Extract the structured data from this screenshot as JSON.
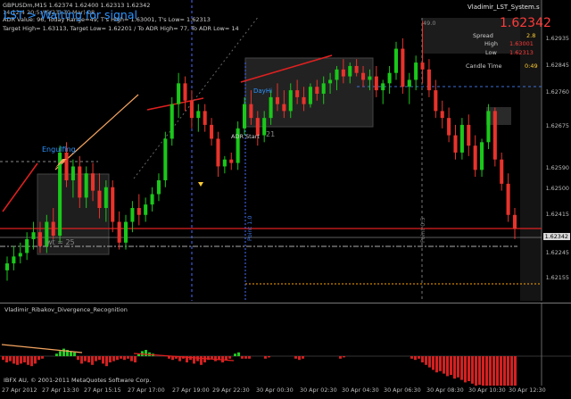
{
  "chart_header": {
    "symbol_line": "GBPUSDm,M15  1.62374 1.62400 1.62313 1.62342",
    "line2": "14:12.4 20:5:/(5/23) 30 Mar) 08",
    "line3": "ADR Value: 96, Today Range=49, T's High= 1.63001, T's Low= 1.62313",
    "line4": "Target High= 1.63113, Target Low= 1.62201 / To ADR High= 77, To ADR Low= 14",
    "status": "LST > Waiting for signal",
    "top_right_title": "Vladimir_LST_System.s"
  },
  "info_panel": {
    "price": "1.62342",
    "spread_label": "Spread",
    "spread_value": "2.8",
    "high_label": "High",
    "high_value": "1.63001",
    "low_label": "Low",
    "low_value": "1.62313",
    "candle_label": "Candle Time",
    "candle_value": "0:49",
    "small_num": "49.0"
  },
  "annotations": {
    "engulfing": "Engulfing",
    "dayhi": "DayHi",
    "adr_start": "ADR Start",
    "num21": "21",
    "wt": "wt = 25",
    "vline1": "Point 1.0",
    "vline2": "Point 0.5"
  },
  "price_axis": {
    "labels": [
      "1.62935",
      "1.62845",
      "1.62760",
      "1.62675",
      "1.62590",
      "1.62500",
      "1.62415",
      "1.62342",
      "1.62245",
      "1.62155"
    ],
    "current": "1.62342"
  },
  "subwindow": {
    "title": "Vladimir_Ribakov_Divergence_Recognition",
    "footer": "IBFX AU, © 2001-2011 MetaQuotes Software Corp."
  },
  "time_axis": [
    "27 Apr 2012",
    "27 Apr 13:30",
    "27 Apr 15:15",
    "27 Apr 17:00",
    "27 Apr 19:00",
    "29 Apr 22:30",
    "30 Apr 00:30",
    "30 Apr 02:30",
    "30 Apr 04:30",
    "30 Apr 06:30",
    "30 Apr 08:30",
    "30 Apr 10:30",
    "30 Apr 12:30"
  ],
  "colors": {
    "bull": "#1ac81a",
    "bear": "#e8332b",
    "bg": "#000000",
    "label_blue": "#2c93ff",
    "price_red": "#ff3b3b"
  },
  "chart_data": {
    "type": "candlestick",
    "ylim": [
      1.6215,
      1.6298
    ],
    "candles": [
      [
        1.6222,
        1.6226,
        1.6219,
        1.6224
      ],
      [
        1.6224,
        1.6229,
        1.6222,
        1.6226
      ],
      [
        1.6226,
        1.623,
        1.6224,
        1.6227
      ],
      [
        1.6227,
        1.6233,
        1.6225,
        1.6231
      ],
      [
        1.6231,
        1.6236,
        1.6228,
        1.6233
      ],
      [
        1.6233,
        1.6236,
        1.6227,
        1.6229
      ],
      [
        1.6229,
        1.6238,
        1.6227,
        1.6236
      ],
      [
        1.6236,
        1.624,
        1.6231,
        1.6232
      ],
      [
        1.6232,
        1.6258,
        1.623,
        1.6256
      ],
      [
        1.6256,
        1.6259,
        1.6246,
        1.6248
      ],
      [
        1.6248,
        1.6254,
        1.6243,
        1.6252
      ],
      [
        1.6252,
        1.6255,
        1.624,
        1.6243
      ],
      [
        1.6243,
        1.6252,
        1.624,
        1.625
      ],
      [
        1.625,
        1.6253,
        1.6242,
        1.6245
      ],
      [
        1.6245,
        1.625,
        1.6237,
        1.624
      ],
      [
        1.624,
        1.6248,
        1.6236,
        1.6246
      ],
      [
        1.6246,
        1.6248,
        1.6233,
        1.6236
      ],
      [
        1.6236,
        1.6239,
        1.6228,
        1.623
      ],
      [
        1.623,
        1.6238,
        1.6228,
        1.6236
      ],
      [
        1.6236,
        1.6242,
        1.6233,
        1.624
      ],
      [
        1.624,
        1.6244,
        1.6235,
        1.6238
      ],
      [
        1.6238,
        1.6243,
        1.6236,
        1.6241
      ],
      [
        1.6241,
        1.6246,
        1.6239,
        1.6244
      ],
      [
        1.6244,
        1.625,
        1.6242,
        1.6248
      ],
      [
        1.6248,
        1.6262,
        1.6246,
        1.626
      ],
      [
        1.626,
        1.6272,
        1.6258,
        1.627
      ],
      [
        1.627,
        1.6279,
        1.6266,
        1.6276
      ],
      [
        1.6276,
        1.6278,
        1.6268,
        1.6271
      ],
      [
        1.6271,
        1.6274,
        1.6263,
        1.6266
      ],
      [
        1.6266,
        1.627,
        1.6262,
        1.6268
      ],
      [
        1.6268,
        1.627,
        1.6262,
        1.6264
      ],
      [
        1.6264,
        1.6266,
        1.6258,
        1.626
      ],
      [
        1.626,
        1.6262,
        1.6249,
        1.6252
      ],
      [
        1.6252,
        1.6255,
        1.625,
        1.6254
      ],
      [
        1.6254,
        1.6256,
        1.6251,
        1.6253
      ],
      [
        1.6253,
        1.6265,
        1.6251,
        1.6263
      ],
      [
        1.6263,
        1.6272,
        1.6261,
        1.627
      ],
      [
        1.627,
        1.6274,
        1.6264,
        1.6266
      ],
      [
        1.6266,
        1.6268,
        1.6258,
        1.6261
      ],
      [
        1.6261,
        1.6268,
        1.6259,
        1.6266
      ],
      [
        1.6266,
        1.6274,
        1.6264,
        1.6272
      ],
      [
        1.6272,
        1.6276,
        1.6268,
        1.627
      ],
      [
        1.627,
        1.6274,
        1.6266,
        1.6268
      ],
      [
        1.6268,
        1.6276,
        1.6266,
        1.6274
      ],
      [
        1.6274,
        1.6277,
        1.627,
        1.6272
      ],
      [
        1.6272,
        1.6275,
        1.6268,
        1.627
      ],
      [
        1.627,
        1.6276,
        1.6269,
        1.6275
      ],
      [
        1.6275,
        1.6277,
        1.6271,
        1.6273
      ],
      [
        1.6273,
        1.6278,
        1.627,
        1.6276
      ],
      [
        1.6276,
        1.6279,
        1.6273,
        1.6277
      ],
      [
        1.6277,
        1.6281,
        1.6274,
        1.628
      ],
      [
        1.628,
        1.6283,
        1.6276,
        1.6278
      ],
      [
        1.6278,
        1.6282,
        1.6276,
        1.6281
      ],
      [
        1.6281,
        1.6283,
        1.6278,
        1.6279
      ],
      [
        1.6279,
        1.6281,
        1.6275,
        1.6277
      ],
      [
        1.6277,
        1.628,
        1.6274,
        1.6278
      ],
      [
        1.6278,
        1.6281,
        1.6272,
        1.6274
      ],
      [
        1.6274,
        1.6277,
        1.627,
        1.6276
      ],
      [
        1.6276,
        1.6281,
        1.6273,
        1.6279
      ],
      [
        1.6279,
        1.6288,
        1.6277,
        1.6286
      ],
      [
        1.6286,
        1.6289,
        1.6273,
        1.6275
      ],
      [
        1.6275,
        1.6279,
        1.627,
        1.6277
      ],
      [
        1.6277,
        1.6284,
        1.6274,
        1.6282
      ],
      [
        1.6282,
        1.6294,
        1.6276,
        1.628
      ],
      [
        1.628,
        1.6283,
        1.6272,
        1.6274
      ],
      [
        1.6274,
        1.6277,
        1.6266,
        1.6268
      ],
      [
        1.6268,
        1.6271,
        1.6263,
        1.6266
      ],
      [
        1.6266,
        1.6269,
        1.6259,
        1.6261
      ],
      [
        1.6261,
        1.6264,
        1.6254,
        1.6256
      ],
      [
        1.6256,
        1.6266,
        1.6254,
        1.6264
      ],
      [
        1.6264,
        1.6267,
        1.6255,
        1.6258
      ],
      [
        1.6258,
        1.6261,
        1.6249,
        1.6251
      ],
      [
        1.6251,
        1.626,
        1.6249,
        1.6259
      ],
      [
        1.6259,
        1.627,
        1.6257,
        1.6268
      ],
      [
        1.6268,
        1.6269,
        1.6252,
        1.6254
      ],
      [
        1.6254,
        1.6256,
        1.6245,
        1.6247
      ],
      [
        1.6247,
        1.625,
        1.6236,
        1.6238
      ],
      [
        1.6238,
        1.624,
        1.6231,
        1.6234
      ]
    ]
  }
}
